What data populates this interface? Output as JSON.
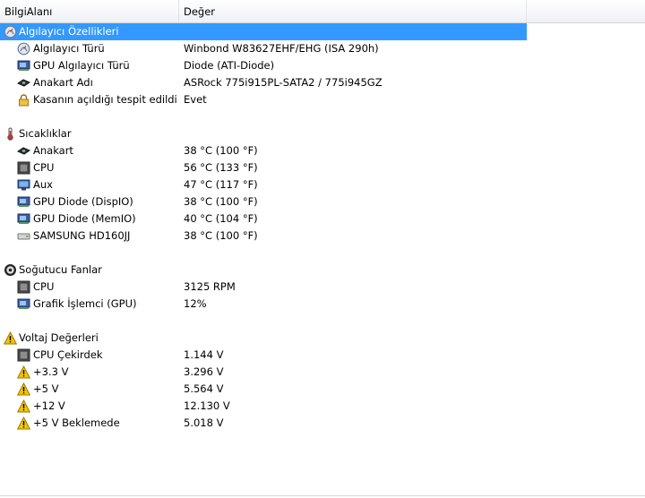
{
  "header": {
    "col_field": "BilgiAlanı",
    "col_value": "Değer"
  },
  "groups": [
    {
      "title": "Algılayıcı Özellikleri",
      "icon": "sensor-icon",
      "selected": true,
      "items": [
        {
          "label": "Algılayıcı Türü",
          "value": "Winbond W83627EHF/EHG  (ISA 290h)",
          "icon": "sensor-icon"
        },
        {
          "label": "GPU Algılayıcı Türü",
          "value": "Diode  (ATI-Diode)",
          "icon": "gpu-icon"
        },
        {
          "label": "Anakart Adı",
          "value": "ASRock 775i915PL-SATA2 / 775i945GZ",
          "icon": "motherboard-icon"
        },
        {
          "label": "Kasanın açıldığı tespit edildi",
          "value": "Evet",
          "icon": "lock-icon"
        }
      ]
    },
    {
      "title": "Sıcaklıklar",
      "icon": "thermometer-icon",
      "selected": false,
      "items": [
        {
          "label": "Anakart",
          "value": "38 °C  (100 °F)",
          "icon": "motherboard-icon"
        },
        {
          "label": "CPU",
          "value": "56 °C  (133 °F)",
          "icon": "cpu-icon"
        },
        {
          "label": "Aux",
          "value": "47 °C  (117 °F)",
          "icon": "monitor-icon"
        },
        {
          "label": "GPU Diode (DispIO)",
          "value": "38 °C  (100 °F)",
          "icon": "gpu-icon"
        },
        {
          "label": "GPU Diode (MemIO)",
          "value": "40 °C  (104 °F)",
          "icon": "gpu-icon"
        },
        {
          "label": "SAMSUNG HD160JJ",
          "value": "38 °C  (100 °F)",
          "icon": "hard-drive-icon"
        }
      ]
    },
    {
      "title": "Soğutucu Fanlar",
      "icon": "fan-icon",
      "selected": false,
      "items": [
        {
          "label": "CPU",
          "value": "3125 RPM",
          "icon": "cpu-icon"
        },
        {
          "label": "Grafik İşlemci (GPU)",
          "value": "12%",
          "icon": "gpu-icon"
        }
      ]
    },
    {
      "title": "Voltaj Değerleri",
      "icon": "warning-icon",
      "selected": false,
      "items": [
        {
          "label": "CPU Çekirdek",
          "value": "1.144 V",
          "icon": "cpu-icon"
        },
        {
          "label": "+3.3 V",
          "value": "3.296 V",
          "icon": "warning-icon"
        },
        {
          "label": "+5 V",
          "value": "5.564 V",
          "icon": "warning-icon"
        },
        {
          "label": "+12 V",
          "value": "12.130 V",
          "icon": "warning-icon"
        },
        {
          "label": "+5 V Beklemede",
          "value": "5.018 V",
          "icon": "warning-icon"
        }
      ]
    }
  ]
}
